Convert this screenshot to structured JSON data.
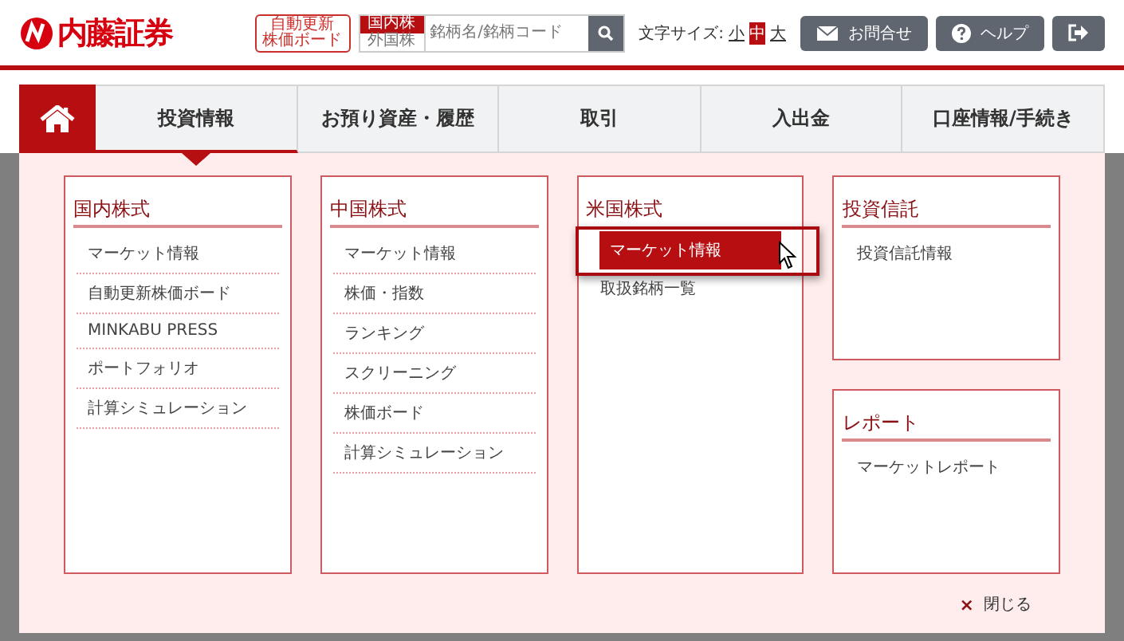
{
  "header": {
    "logo": "内藤証券",
    "board_button": [
      "自動更新",
      "株価ボード"
    ],
    "market_toggle": [
      {
        "label": "国内株",
        "selected": true
      },
      {
        "label": "外国株",
        "selected": false
      }
    ],
    "search": {
      "placeholder": "銘柄名/銘柄コード"
    },
    "text_size": {
      "label": "文字サイズ:",
      "options": [
        {
          "label": "小",
          "selected": false
        },
        {
          "label": "中",
          "selected": true
        },
        {
          "label": "大",
          "selected": false
        }
      ]
    },
    "buttons": [
      {
        "kind": "mail",
        "label": "お問合せ"
      },
      {
        "kind": "help",
        "label": "ヘルプ"
      },
      {
        "kind": "logout"
      }
    ]
  },
  "nav": {
    "tabs": [
      {
        "label": "投資情報",
        "selected": true
      },
      {
        "label": "お預り資産・履歴",
        "selected": false
      },
      {
        "label": "取引",
        "selected": false
      },
      {
        "label": "入出金",
        "selected": false
      },
      {
        "label": "口座情報/手続き",
        "selected": false
      }
    ]
  },
  "menu": {
    "columns": [
      {
        "sections": [
          {
            "title": "国内株式",
            "items": [
              {
                "label": "マーケット情報",
                "selected": false
              },
              {
                "label": "自動更新株価ボード",
                "selected": false
              },
              {
                "label": "MINKABU PRESS",
                "selected": false
              },
              {
                "label": "ポートフォリオ",
                "selected": false
              },
              {
                "label": "計算シミュレーション",
                "selected": false
              }
            ]
          }
        ]
      },
      {
        "sections": [
          {
            "title": "中国株式",
            "items": [
              {
                "label": "マーケット情報",
                "selected": false
              },
              {
                "label": "株価・指数",
                "selected": false
              },
              {
                "label": "ランキング",
                "selected": false
              },
              {
                "label": "スクリーニング",
                "selected": false
              },
              {
                "label": "株価ボード",
                "selected": false
              },
              {
                "label": "計算シミュレーション",
                "selected": false
              }
            ]
          }
        ]
      },
      {
        "sections": [
          {
            "title": "米国株式",
            "items": [
              {
                "label": "マーケット情報",
                "selected": true
              },
              {
                "label": "取扱銘柄一覧",
                "selected": false
              }
            ]
          }
        ]
      },
      {
        "sections": [
          {
            "title": "投資信託",
            "items": [
              {
                "label": "投資信託情報",
                "selected": false
              }
            ]
          },
          {
            "title": "レポート",
            "items": [
              {
                "label": "マーケットレポート",
                "selected": false
              }
            ]
          }
        ]
      }
    ],
    "close": {
      "icon": "×",
      "label": "閉じる"
    }
  }
}
